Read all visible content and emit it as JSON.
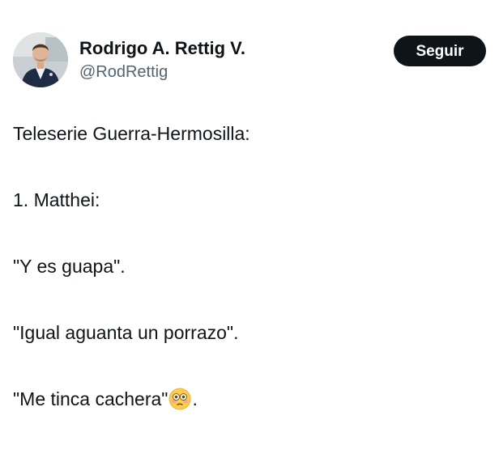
{
  "author": {
    "display_name": "Rodrigo A. Rettig V.",
    "handle": "@RodRettig",
    "avatar_icon": "profile-photo-avatar"
  },
  "actions": {
    "follow_label": "Seguir"
  },
  "tweet": {
    "lines": [
      "Teleserie Guerra-Hermosilla:",
      "1. Matthei:",
      "\"Y es guapa\".",
      "\"Igual aguanta un porrazo\"."
    ],
    "last_line_before_emoji": "\"Me tinca cachera\"",
    "last_line_emoji": "flushed-face-icon",
    "last_line_after_emoji": "."
  },
  "colors": {
    "text": "#0f1419",
    "secondary_text": "#536471",
    "button_bg": "#0f1419",
    "button_text": "#ffffff",
    "background": "#ffffff"
  }
}
